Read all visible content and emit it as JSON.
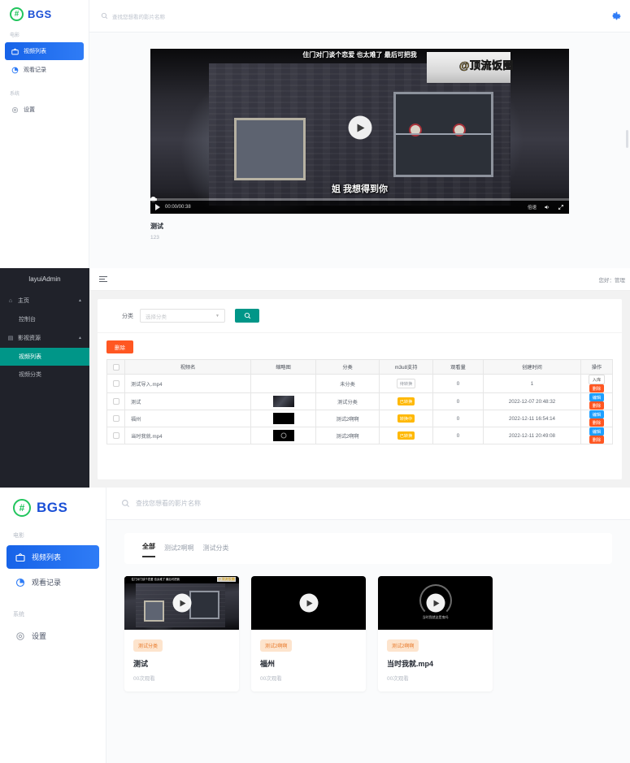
{
  "frontend": {
    "brand": {
      "mark": "#",
      "name": "BGS"
    },
    "search_placeholder": "查找您想看的影片名称",
    "nav_groups": [
      {
        "label": "电影",
        "items": [
          {
            "label": "视频列表",
            "icon": "tv-icon",
            "active": true
          },
          {
            "label": "观看记录",
            "icon": "clock-pie-icon",
            "active": false
          }
        ]
      },
      {
        "label": "系统",
        "items": [
          {
            "label": "设置",
            "icon": "gear-icon",
            "active": false
          }
        ]
      }
    ],
    "settings_icon": "gear-icon"
  },
  "player": {
    "subtitle_top": "住门对门谈个恋爱 也太难了 最后可把我",
    "watermark": "@顶流饭圈",
    "subtitle_mid": "姐 我想得到你",
    "time": "00:00/00:38",
    "speed_label": "倍速",
    "volume_label": "0",
    "video_title": "测试",
    "video_desc": "123",
    "play_icon": "play-icon",
    "volume_icon": "volume-icon",
    "fullscreen_icon": "fullscreen-icon"
  },
  "admin": {
    "logo": "layuiAdmin",
    "greeting": "您好：管理",
    "menu": [
      {
        "label": "主页",
        "icon": "home-icon",
        "expanded": true,
        "children": [
          {
            "label": "控制台",
            "active": false
          }
        ]
      },
      {
        "label": "影视资源",
        "icon": "film-icon",
        "expanded": true,
        "children": [
          {
            "label": "视频列表",
            "active": true
          },
          {
            "label": "视频分类",
            "active": false
          }
        ]
      }
    ],
    "filter": {
      "label": "分类",
      "select_value": "选择分类",
      "search_icon": "search-icon"
    },
    "delete_button": "删除",
    "table": {
      "columns": [
        "",
        "视频名",
        "缩略图",
        "分类",
        "m3u8支持",
        "观看量",
        "创建时间",
        "操作"
      ],
      "rows": [
        {
          "name": "测试导入.mp4",
          "thumb": "none",
          "category": "未分类",
          "m3u8": "待转换",
          "m3u8_style": "wait",
          "views": "0",
          "created": "1",
          "action1": "入库",
          "action1_style": "store",
          "action2": "删除"
        },
        {
          "name": "测试",
          "thumb": "photo",
          "category": "测试分类",
          "m3u8": "已转换",
          "m3u8_style": "ok",
          "views": "0",
          "created": "2022-12-07 20:48:32",
          "action1": "编辑",
          "action1_style": "edit",
          "action2": "删除"
        },
        {
          "name": "福州",
          "thumb": "black",
          "category": "测试2啊啊",
          "m3u8": "转换中",
          "m3u8_style": "ing",
          "views": "0",
          "created": "2022-12-11 16:54:14",
          "action1": "编辑",
          "action1_style": "edit",
          "action2": "删除"
        },
        {
          "name": "当时我就.mp4",
          "thumb": "ring",
          "category": "测试2啊啊",
          "m3u8": "已转换",
          "m3u8_style": "ok",
          "views": "0",
          "created": "2022-12-11 20:49:08",
          "action1": "编辑",
          "action1_style": "edit",
          "action2": "删除"
        }
      ]
    }
  },
  "grid": {
    "tabs": [
      {
        "label": "全部",
        "active": true
      },
      {
        "label": "测试2啊啊",
        "active": false
      },
      {
        "label": "测试分类",
        "active": false
      }
    ],
    "cards": [
      {
        "tag": "测试分类",
        "title": "测试",
        "views": "00次观看",
        "thumb": "scene-a"
      },
      {
        "tag": "测试2啊啊",
        "title": "福州",
        "views": "00次观看",
        "thumb": "scene-b"
      },
      {
        "tag": "测试2啊啊",
        "title": "当时我就.mp4",
        "views": "00次观看",
        "thumb": "scene-c",
        "caption": "当时我就这是鬼吗"
      }
    ]
  },
  "colors": {
    "brand_blue": "#1763e8",
    "brand_green": "#22c55e",
    "admin_teal": "#009688",
    "danger_orange": "#ff5722",
    "badge_yellow": "#ffb800",
    "tag_bg": "#fde4cd",
    "tag_fg": "#e87b2d"
  }
}
